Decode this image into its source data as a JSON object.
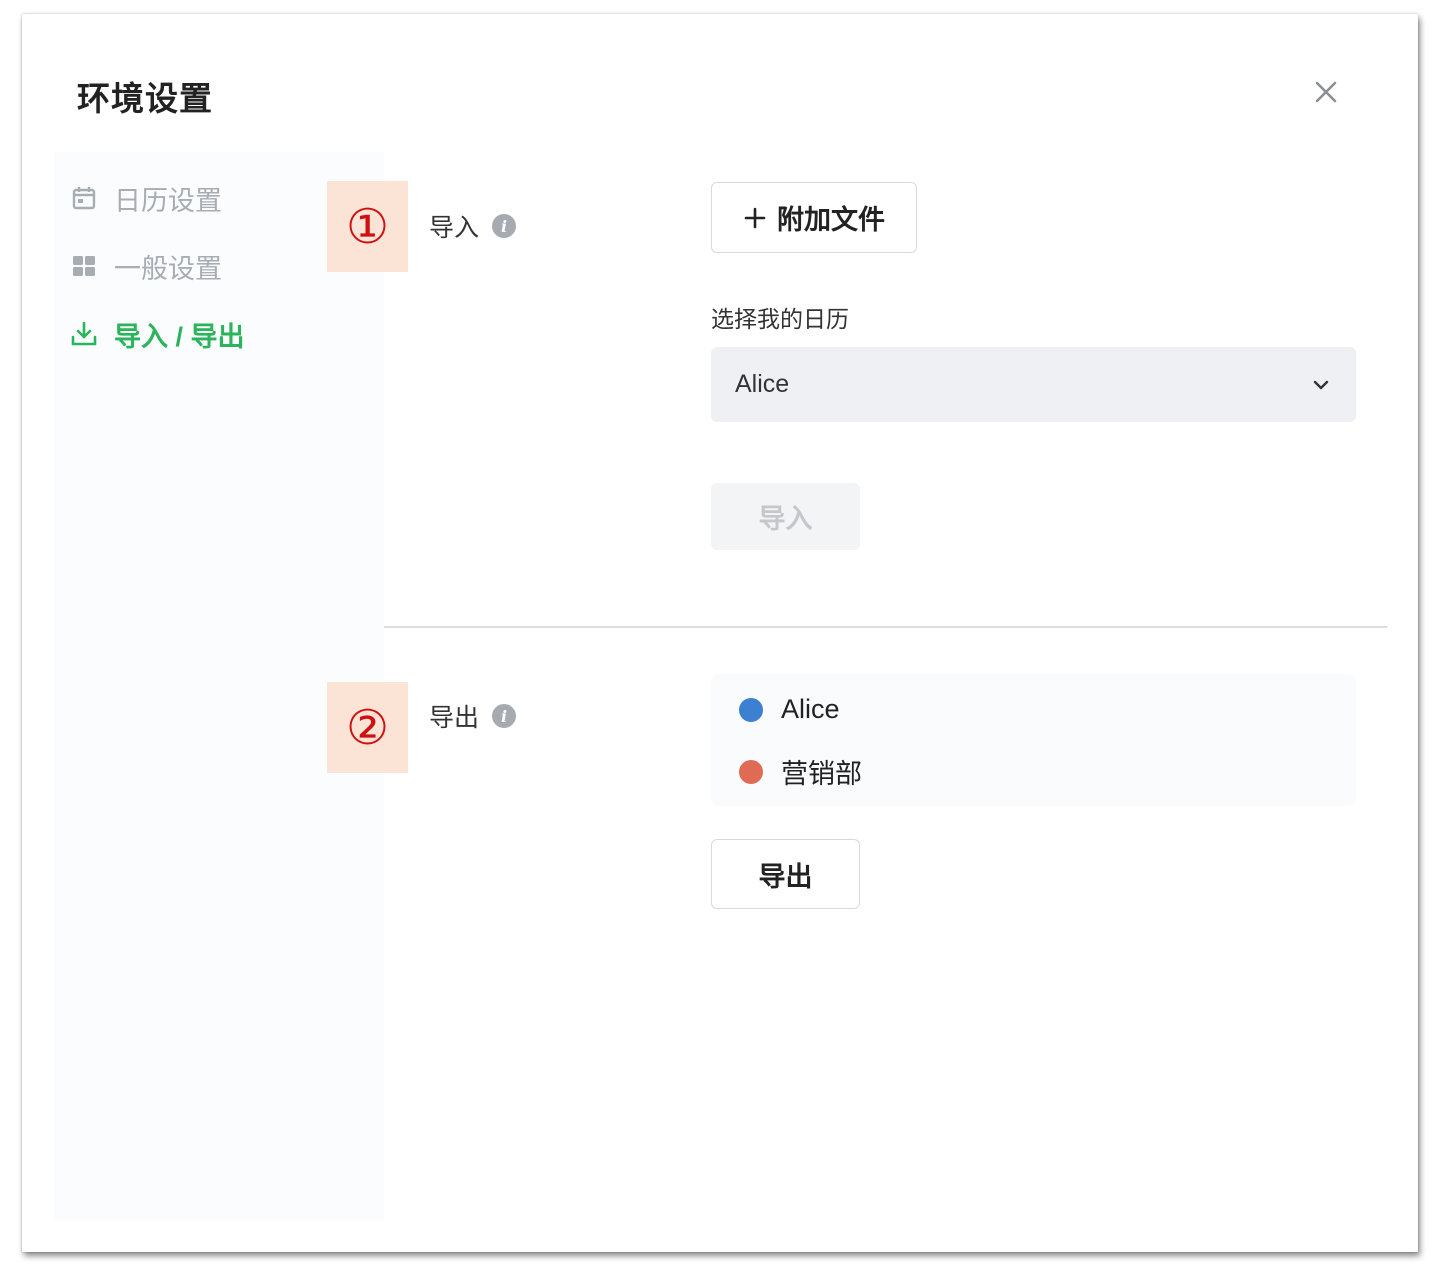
{
  "dialog": {
    "title": "环境设置"
  },
  "sidebar": {
    "items": [
      {
        "label": "日历设置",
        "icon": "calendar-icon"
      },
      {
        "label": "一般设置",
        "icon": "grid-icon"
      },
      {
        "label": "导入 / 导出",
        "icon": "download-icon",
        "active": true
      }
    ]
  },
  "import_section": {
    "marker": "①",
    "label": "导入",
    "attach_button": "附加文件",
    "calendar_label": "选择我的日历",
    "calendar_selected": "Alice",
    "import_button": "导入"
  },
  "export_section": {
    "marker": "②",
    "label": "导出",
    "calendars": [
      {
        "name": "Alice",
        "color": "#3d7fd1"
      },
      {
        "name": "营销部",
        "color": "#e06b55"
      }
    ],
    "export_button": "导出"
  },
  "colors": {
    "accent": "#2bb45c",
    "marker_bg": "#fbe3d6",
    "marker_text": "#d01010"
  }
}
